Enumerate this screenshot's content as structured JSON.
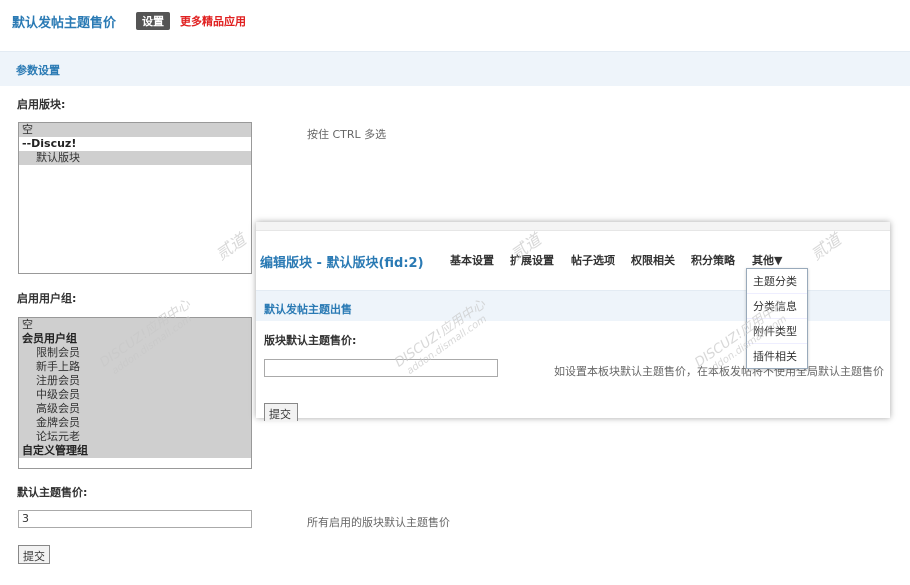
{
  "header": {
    "title": "默认发帖主题售价",
    "settings_tab": "设置",
    "more_link": "更多精品应用"
  },
  "params": {
    "section_title": "参数设置",
    "forums_label": "启用版块:",
    "forums_hint": "按住 CTRL 多选",
    "forums_options": [
      "空",
      "--Discuz!",
      "默认版块"
    ],
    "groups_label": "启用用户组:",
    "groups_options": [
      "空",
      "会员用户组",
      "限制会员",
      "新手上路",
      "注册会员",
      "中级会员",
      "高级会员",
      "金牌会员",
      "论坛元老",
      "自定义管理组"
    ],
    "price_label": "默认主题售价:",
    "price_value": "3",
    "price_hint": "所有启用的版块默认主题售价",
    "submit_label": "提交"
  },
  "panel": {
    "title": "编辑版块 - 默认版块(fid:2)",
    "nav": [
      "基本设置",
      "扩展设置",
      "帖子选项",
      "权限相关",
      "积分策略",
      "其他▼"
    ],
    "section_title": "默认发帖主题出售",
    "price_label": "版块默认主题售价:",
    "price_value": "",
    "price_hint": "如设置本板块默认主题售价，在本板发帖将不使用全局默认主题售价",
    "submit_label": "提交",
    "dropdown": [
      "主题分类",
      "分类信息",
      "附件类型",
      "插件相关"
    ]
  },
  "watermark": {
    "brand": "DISCUZ!应用中心",
    "site": "addon.dismall.com",
    "mark": "贰道"
  },
  "colors": {
    "link_blue": "#2a7ab4",
    "accent_red": "#e02020",
    "section_bg": "#eef4fa",
    "selected_option": "#cfcfcf"
  }
}
